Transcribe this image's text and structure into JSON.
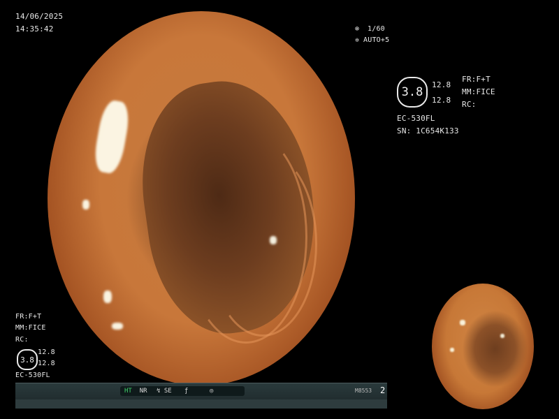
{
  "overlay": {
    "date": "14/06/2025",
    "time": "14:35:42",
    "shutter": "1/60",
    "auto_label": "AUTO+5",
    "shutter_icon": "shutter-icon",
    "auto_icon": "iris-icon"
  },
  "right_panel": {
    "badge_value": "3.8",
    "val_top": "12.8",
    "val_bottom": "12.8",
    "fr": "FR:F+T",
    "mm": "MM:FICE",
    "rc": "RC:",
    "scope_model": "EC-530FL",
    "serial": "SN: 1C654K133"
  },
  "left_panel": {
    "fr": "FR:F+T",
    "mm": "MM:FICE",
    "rc": "RC:",
    "badge_value": "3.8",
    "val_top": "12.8",
    "val_bottom": "12.8",
    "scope_model": "EC-530FL"
  },
  "status_bar": {
    "ht": "HT",
    "nr": "NR",
    "se": "SE",
    "code": "M8553",
    "count": "2"
  },
  "colors": {
    "accent_green": "#3fd46a",
    "tissue": "#c57a3e"
  }
}
